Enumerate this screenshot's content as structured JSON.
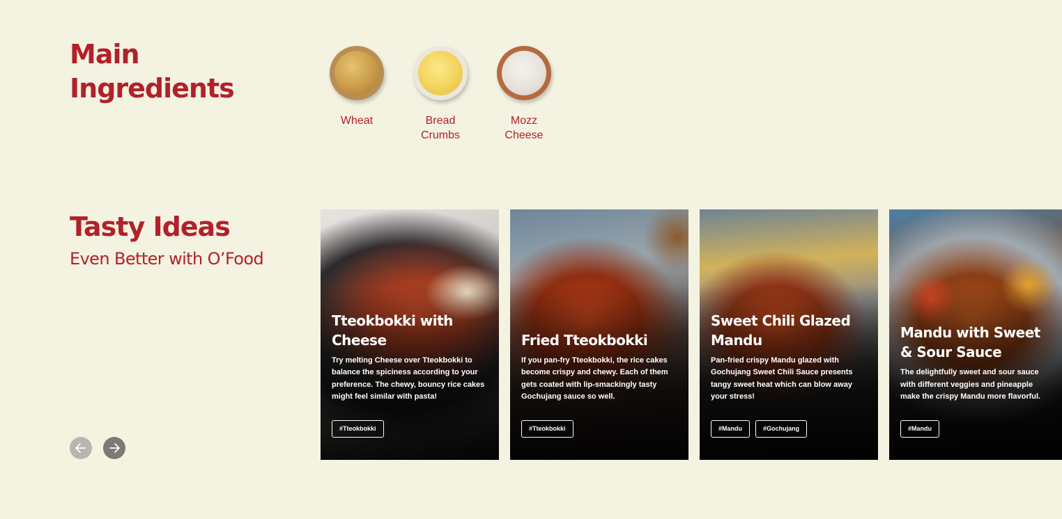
{
  "main_ingredients": {
    "title_line1": "Main",
    "title_line2": "Ingredients",
    "items": [
      {
        "name_line1": "Wheat",
        "name_line2": ""
      },
      {
        "name_line1": "Bread",
        "name_line2": "Crumbs"
      },
      {
        "name_line1": "Mozz",
        "name_line2": "Cheese"
      }
    ]
  },
  "tasty_ideas": {
    "title": "Tasty Ideas",
    "subtitle": "Even Better with O’Food",
    "cards": [
      {
        "title": "Tteokbokki with Cheese",
        "description": "Try melting Cheese over Tteokbokki to balance the spiciness according to your preference. The chewy, bouncy rice cakes might feel similar with pasta!",
        "tags": [
          "#Tteokbokki"
        ]
      },
      {
        "title": "Fried Tteokbokki",
        "description": "If you pan-fry Tteokbokki, the rice cakes become crispy and chewy. Each of them gets coated with lip-smackingly tasty Gochujang sauce so well.",
        "tags": [
          "#Tteokbokki"
        ]
      },
      {
        "title": "Sweet Chili Glazed Mandu",
        "description": "Pan-fried crispy Mandu glazed with Gochujang Sweet Chili Sauce presents tangy sweet heat which can blow away your stress!",
        "tags": [
          "#Mandu",
          "#Gochujang"
        ]
      },
      {
        "title": "Mandu with Sweet & Sour Sauce",
        "description": "The delightfully sweet and sour sauce with different veggies and pineapple make the crispy Mandu more flavorful.",
        "tags": [
          "#Mandu"
        ]
      }
    ]
  },
  "carousel_nav": {
    "prev_icon": "arrow-left-icon",
    "next_icon": "arrow-right-icon"
  },
  "colors": {
    "background": "#f4f2e1",
    "accent": "#b1212a",
    "nav_prev": "#b7b5ad",
    "nav_next": "#7b7a77"
  }
}
